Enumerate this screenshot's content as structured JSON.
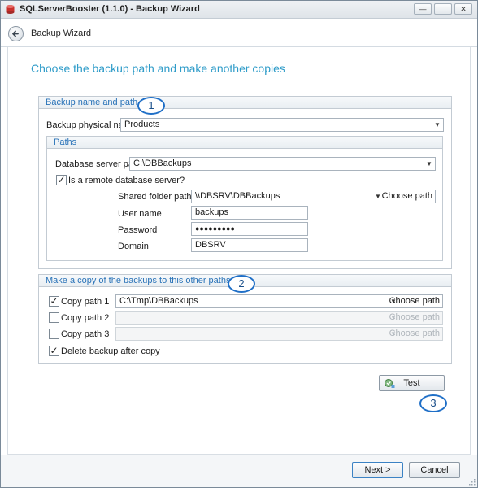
{
  "window": {
    "title": "SQLServerBooster (1.1.0) - Backup Wizard",
    "minimize": "—",
    "maximize": "□",
    "close": "✕"
  },
  "header": {
    "title": "Backup Wizard"
  },
  "page_title": "Choose the backup path and make another copies",
  "backup_group": {
    "title": "Backup name and path",
    "physical_name_label": "Backup physical name",
    "physical_name_value": "Products",
    "paths_title": "Paths",
    "db_server_path_label": "Database server path",
    "db_server_path_value": "C:\\DBBackups",
    "remote_checkbox_label": "Is a remote database server?",
    "remote_checked": true,
    "shared_folder_label": "Shared folder path",
    "shared_folder_value": "\\\\DBSRV\\DBBackups",
    "choose_path_label": "Choose path",
    "user_name_label": "User name",
    "user_name_value": "backups",
    "password_label": "Password",
    "password_value": "●●●●●●●●●",
    "domain_label": "Domain",
    "domain_value": "DBSRV"
  },
  "copies_group": {
    "title": "Make a copy of the backups to this other paths",
    "copy1_label": "Copy path 1",
    "copy1_value": "C:\\Tmp\\DBBackups",
    "copy1_checked": true,
    "copy2_label": "Copy path 2",
    "copy2_checked": false,
    "copy3_label": "Copy path 3",
    "copy3_checked": false,
    "choose_path_label": "Choose path",
    "delete_after_label": "Delete backup after copy",
    "delete_after_checked": true
  },
  "callouts": {
    "one": "1",
    "two": "2",
    "three": "3"
  },
  "test_button": "Test",
  "footer": {
    "next": "Next >",
    "cancel": "Cancel"
  },
  "icons": {
    "app": "database-icon",
    "back": "back-arrow-icon",
    "test": "test-connection-icon",
    "dropdown": "chevron-down-icon"
  },
  "colors": {
    "page_title": "#2f9cc9",
    "group_title": "#2a73b8",
    "callout": "#1f6fc7"
  },
  "checkmark": "✓",
  "dropdown_arrow": "▼"
}
